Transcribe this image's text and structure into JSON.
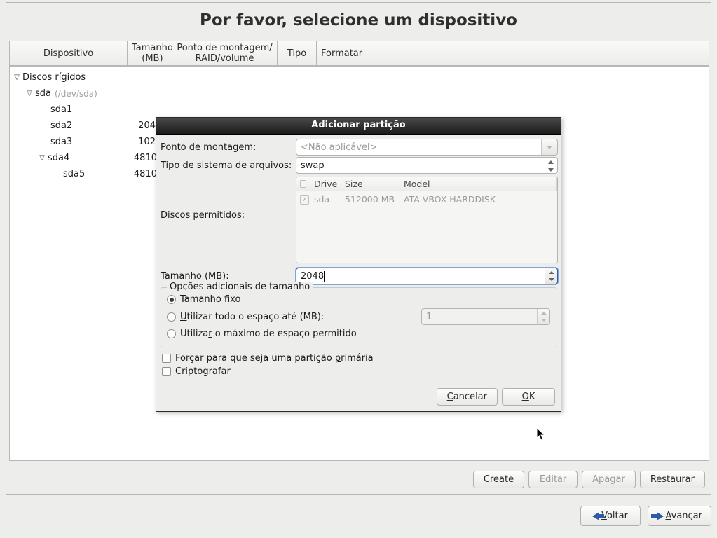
{
  "page_title": "Por favor, selecione um dispositivo",
  "columns": {
    "device": "Dispositivo",
    "size": "Tamanho (MB)",
    "mount": "Ponto de montagem/ RAID/volume",
    "type": "Tipo",
    "format": "Formatar"
  },
  "tree": {
    "root": "Discos rígidos",
    "sda": "sda",
    "sda_path": "(/dev/sda)",
    "sda1": "sda1",
    "sda2": "sda2",
    "sda2_size_trunc": "204",
    "sda3": "sda3",
    "sda3_size_trunc": "102",
    "sda4": "sda4",
    "sda4_size_trunc": "4810",
    "sda5": "sda5",
    "sda5_size_trunc": "4810"
  },
  "main_buttons": {
    "create": "Create",
    "edit": "Editar",
    "delete": "Apagar",
    "restore": "Restaurar"
  },
  "nav": {
    "back": "Voltar",
    "next": "Avançar"
  },
  "dialog": {
    "title": "Adicionar partição",
    "mount_label_pre": "Ponto de ",
    "mount_label_u": "m",
    "mount_label_post": "ontagem:",
    "mount_value": "<Não aplicável>",
    "fs_label": "Tipo de sistema de arquivos:",
    "fs_value": "swap",
    "disks_label_u": "D",
    "disks_label_post": "iscos permitidos:",
    "drives_header_drive": "Drive",
    "drives_header_size": "Size",
    "drives_header_model": "Model",
    "drive_name": "sda",
    "drive_size": "512000 MB",
    "drive_model": "ATA VBOX HARDDISK",
    "size_label_u": "T",
    "size_label_post": "amanho (MB):",
    "size_value": "2048",
    "opts_legend": "Opções adicionais de tamanho",
    "opt_fixed_pre": "Tamanho ",
    "opt_fixed_u": "f",
    "opt_fixed_post": "ixo",
    "opt_upto_u": "U",
    "opt_upto_post": "tilizar todo o espaço até (MB):",
    "opt_upto_value": "1",
    "opt_max_pre": "Utiliza",
    "opt_max_u": "r",
    "opt_max_post": " o máximo de espaço permitido",
    "force_primary_pre": "Forçar para que seja uma partição ",
    "force_primary_u": "p",
    "force_primary_post": "rimária",
    "encrypt_u": "C",
    "encrypt_post": "riptografar",
    "cancel_u": "C",
    "cancel_post": "ancelar",
    "ok_u": "O",
    "ok_post": "K"
  }
}
